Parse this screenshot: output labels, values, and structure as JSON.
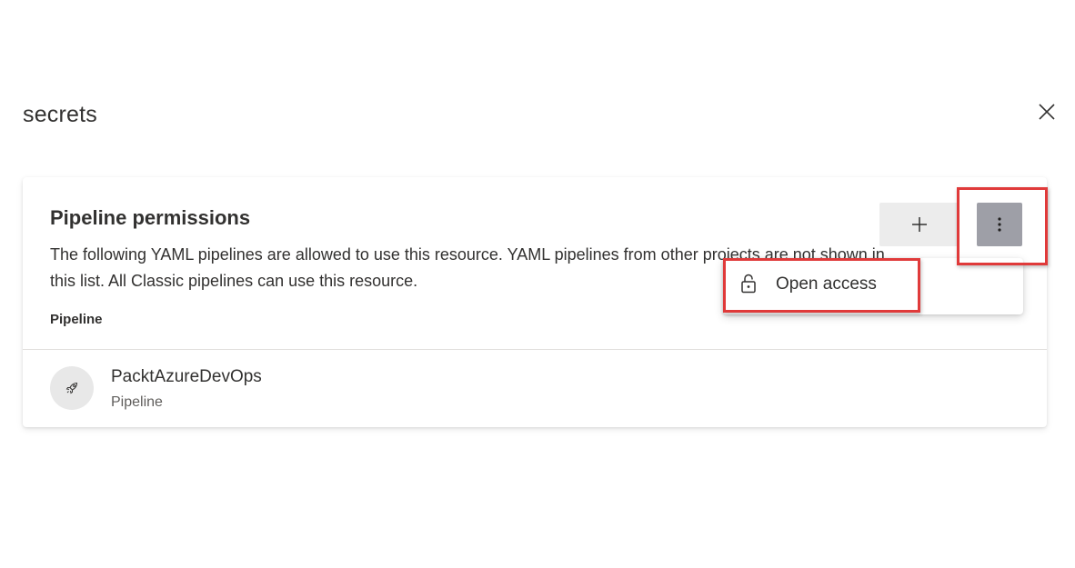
{
  "panel": {
    "title": "secrets"
  },
  "card": {
    "title": "Pipeline permissions",
    "description": "The following YAML pipelines are allowed to use this resource. YAML pipelines from other projects are not shown in this list. All Classic pipelines can use this resource.",
    "column_header": "Pipeline",
    "rows": [
      {
        "name": "PacktAzureDevOps",
        "type": "Pipeline",
        "icon": "rocket-icon"
      }
    ]
  },
  "toolbar": {
    "add_icon": "plus-icon",
    "more_icon": "more-vertical-icon"
  },
  "menu": {
    "items": [
      {
        "label": "Open access",
        "icon": "unlock-icon"
      }
    ]
  },
  "colors": {
    "highlight": "#e03a3a",
    "more_button_bg": "#9e9fa7",
    "add_button_bg": "#ececec"
  }
}
